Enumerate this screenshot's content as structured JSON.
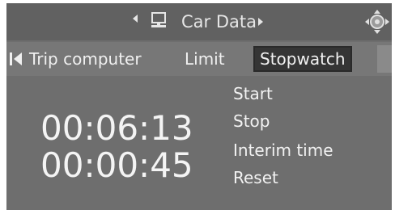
{
  "header": {
    "title": "Car Data",
    "left_icon": "chevron-left-icon",
    "computer_icon": "computer-icon",
    "right_icon": "chevron-right-icon",
    "controller_icon": "controller-icon"
  },
  "tabs": [
    {
      "label": "Trip computer",
      "selected": false
    },
    {
      "label": "Limit",
      "selected": false
    },
    {
      "label": "Stopwatch",
      "selected": true
    }
  ],
  "stopwatch": {
    "time_primary": "00:06:13",
    "time_secondary": "00:00:45"
  },
  "menu": {
    "items": [
      "Start",
      "Stop",
      "Interim time",
      "Reset"
    ]
  },
  "colors": {
    "background": "#6e6e6e",
    "header_background": "#616161",
    "tabbar_background": "#777777",
    "selected_tab": "#353535",
    "text": "#f2f2f2"
  }
}
